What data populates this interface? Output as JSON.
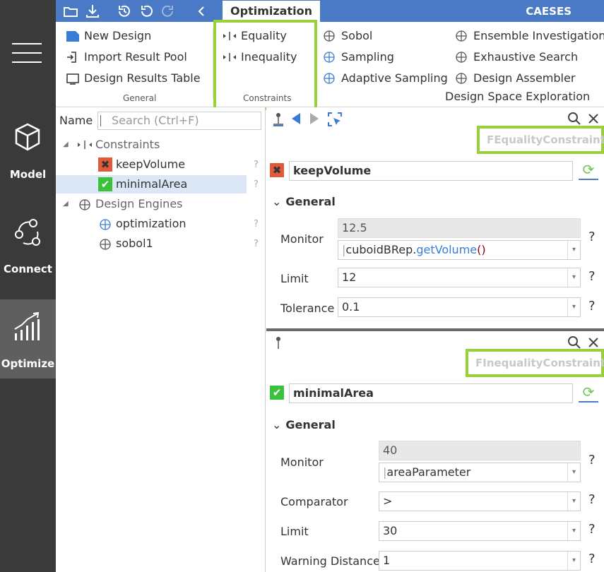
{
  "sidebar": {
    "items": [
      {
        "label": "Model",
        "icon": "cube-icon"
      },
      {
        "label": "Connect",
        "icon": "connect-icon"
      },
      {
        "label": "Optimize",
        "icon": "chart-icon"
      }
    ]
  },
  "topbar": {
    "active_tab": "Optimization",
    "brand": "CAESES"
  },
  "ribbon": {
    "general": {
      "label": "General",
      "items": [
        "New Design",
        "Import Result Pool",
        "Design Results Table"
      ]
    },
    "constraints": {
      "label": "Constraints",
      "items": [
        "Equality",
        "Inequality"
      ]
    },
    "exploration": {
      "label": "Design Space Exploration",
      "items": [
        "Sobol",
        "Sampling",
        "Adaptive Sampling",
        "Ensemble Investigation",
        "Exhaustive Search",
        "Design Assembler"
      ]
    }
  },
  "tree": {
    "name_header": "Name",
    "search_placeholder": "Search (Ctrl+F)",
    "rows": [
      {
        "label": "Constraints"
      },
      {
        "label": "keepVolume"
      },
      {
        "label": "minimalArea"
      },
      {
        "label": "Design Engines"
      },
      {
        "label": "optimization"
      },
      {
        "label": "sobol1"
      }
    ],
    "q": "?"
  },
  "equality_panel": {
    "class_name": "FEqualityConstraint",
    "name": "keepVolume",
    "section": "General",
    "monitor_label": "Monitor",
    "monitor_value": "12.5",
    "monitor_expr_obj": "cuboidBRep",
    "monitor_expr_dot": ".",
    "monitor_expr_fn": "getVolume",
    "monitor_expr_paren": "()",
    "limit_label": "Limit",
    "limit_value": "12",
    "tolerance_label": "Tolerance",
    "tolerance_value": "0.1"
  },
  "inequality_panel": {
    "class_name": "FInequalityConstraint",
    "name": "minimalArea",
    "section": "General",
    "monitor_label": "Monitor",
    "monitor_value": "40",
    "monitor_expr": "areaParameter",
    "comparator_label": "Comparator",
    "comparator_value": ">",
    "limit_label": "Limit",
    "limit_value": "30",
    "warning_label": "Warning Distance",
    "warning_value": "1"
  },
  "help": "?",
  "colors": {
    "accent": "#4a79c6",
    "highlight": "#99d13a",
    "sidebar": "#3a3a3a",
    "error": "#e05a3a",
    "ok": "#3cc13b"
  }
}
